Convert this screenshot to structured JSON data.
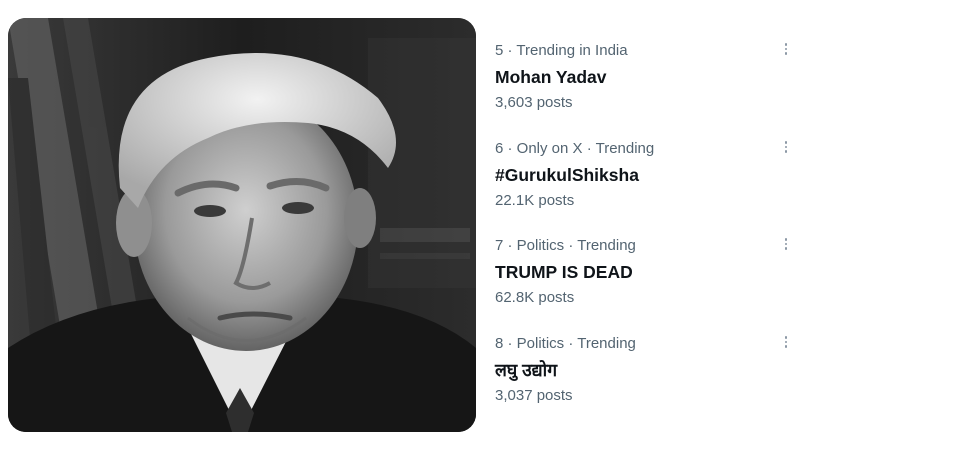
{
  "photo": {
    "icon": "portrait-photo",
    "colors": {
      "bg": "#1a1a1a"
    }
  },
  "trends": [
    {
      "meta": "5 · Trending in India",
      "topic": "Mohan Yadav",
      "posts": "3,603 posts"
    },
    {
      "meta": "6 · Only on X · Trending",
      "topic": "#GurukulShiksha",
      "posts": "22.1K posts"
    },
    {
      "meta": "7 · Politics · Trending",
      "topic": "TRUMP IS DEAD",
      "posts": "62.8K posts"
    },
    {
      "meta": "8 · Politics · Trending",
      "topic": "लघु उद्योग",
      "posts": "3,037 posts"
    }
  ],
  "colors": {
    "secondary_text": "#536471",
    "primary_text": "#0f1419",
    "more_icon": "#8b98a5"
  }
}
